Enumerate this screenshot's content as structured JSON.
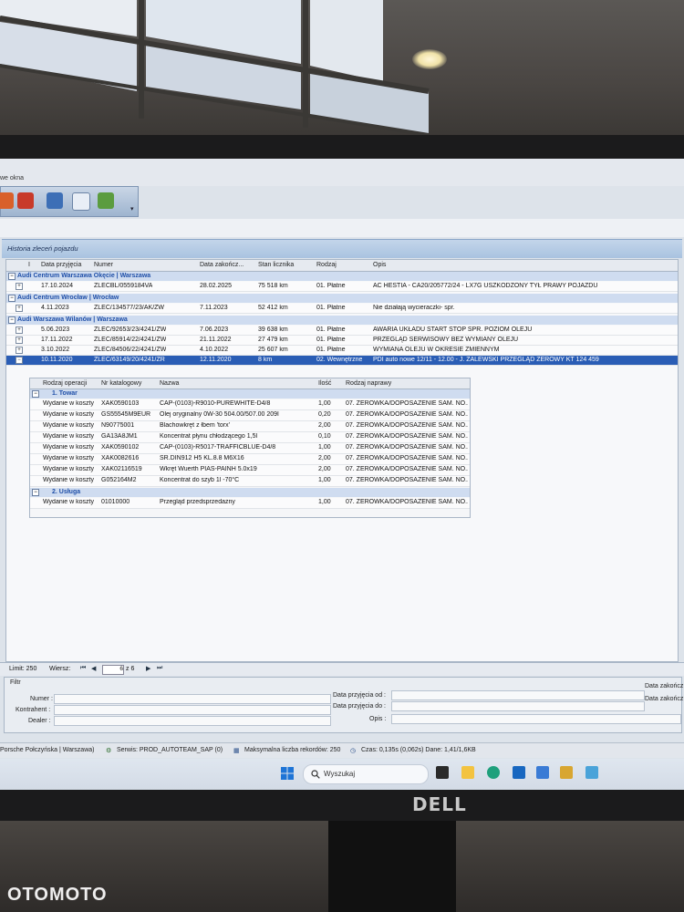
{
  "menu": {
    "text": "we okna"
  },
  "panel_title": "Historia zleceń pojazdu",
  "columns": [
    "Data przyjęcia",
    "Numer",
    "Data zakończ...",
    "Stan licznika",
    "Rodzaj",
    "Opis"
  ],
  "groups": [
    {
      "name": "Audi Centrum Warszawa Okęcie | Warszawa",
      "rows": [
        {
          "date": "17.10.2024",
          "number": "ZLECBL/0559184VA",
          "end": "28.02.2025",
          "km": "75 518 km",
          "type": "01. Płatne",
          "desc": "AC HESTIA - CA20/205772/24 - LX7G USZKODZONY TYŁ PRAWY POJAZDU"
        }
      ]
    },
    {
      "name": "Audi Centrum Wrocław | Wrocław",
      "rows": [
        {
          "date": "4.11.2023",
          "number": "ZLEC/134577/23/AK/ZW",
          "end": "7.11.2023",
          "km": "52 412 km",
          "type": "01. Płatne",
          "desc": "Nie działają wycieraczki- spr."
        }
      ]
    },
    {
      "name": "Audi Warszawa Wilanów | Warszawa",
      "rows": [
        {
          "date": "5.06.2023",
          "number": "ZLEC/92653/23/4241/ZW",
          "end": "7.06.2023",
          "km": "39 638 km",
          "type": "01. Płatne",
          "desc": "AWARIA UKŁADU START STOP SPR. POZIOM OLEJU"
        },
        {
          "date": "17.11.2022",
          "number": "ZLEC/85914/22/4241/ZW",
          "end": "21.11.2022",
          "km": "27 479 km",
          "type": "01. Płatne",
          "desc": "PRZEGLĄD SERWISOWY BEZ WYMIANY OLEJU"
        },
        {
          "date": "3.10.2022",
          "number": "ZLEC/84506/22/4241/ZW",
          "end": "4.10.2022",
          "km": "25 607 km",
          "type": "01. Płatne",
          "desc": "WYMIANA OLEJU W OKRESIE ZMIENNYM"
        },
        {
          "date": "10.11.2020",
          "number": "ZLEC/63149/20/4241/ZR",
          "end": "12.11.2020",
          "km": "8 km",
          "type": "02. Wewnętrzne",
          "desc": "PDI auto nowe  12/11 - 12.00 - J. ZALEWSKI PRZEGLĄD ZEROWY KT  124  459"
        }
      ]
    }
  ],
  "sub_columns": [
    "Rodzaj operacji",
    "Nr katalogowy",
    "Nazwa",
    "Ilość",
    "Rodzaj naprawy"
  ],
  "sub_groups": [
    {
      "name": "1. Towar",
      "rows": [
        {
          "op": "Wydanie w koszty",
          "cat": "XAK0590103",
          "name": "CAP-(0103)-R9010-PUREWHITE-D4/8",
          "qty": "1,00",
          "repair": "07.  ZEROWKA/DOPOSAZENIE  SAM.  NO..."
        },
        {
          "op": "Wydanie w koszty",
          "cat": "GS55545M9EUR",
          "name": "Olej oryginalny 0W-30 504.00/507.00 209l",
          "qty": "0,20",
          "repair": "07.  ZEROWKA/DOPOSAZENIE  SAM.  NO..."
        },
        {
          "op": "Wydanie w koszty",
          "cat": "N90775001",
          "name": "Blachowkręt z łbem 'torx'",
          "qty": "2,00",
          "repair": "07.  ZEROWKA/DOPOSAZENIE  SAM.  NO..."
        },
        {
          "op": "Wydanie w koszty",
          "cat": "GA13A8JM1",
          "name": "Koncentrat płynu chłodzącego 1,5l",
          "qty": "0,10",
          "repair": "07.  ZEROWKA/DOPOSAZENIE  SAM.  NO..."
        },
        {
          "op": "Wydanie w koszty",
          "cat": "XAK0590102",
          "name": "CAP-(0103)-R5017-TRAFFICBLUE-D4/8",
          "qty": "1,00",
          "repair": "07.  ZEROWKA/DOPOSAZENIE  SAM.  NO..."
        },
        {
          "op": "Wydanie w koszty",
          "cat": "XAK0082616",
          "name": "SR.DIN912 H5 KL.8.8 M6X16",
          "qty": "2,00",
          "repair": "07.  ZEROWKA/DOPOSAZENIE  SAM.  NO..."
        },
        {
          "op": "Wydanie w koszty",
          "cat": "XAK02116519",
          "name": "Wkręt Wuerth PIAS-PAINH 5.0x19",
          "qty": "2,00",
          "repair": "07.  ZEROWKA/DOPOSAZENIE  SAM.  NO..."
        },
        {
          "op": "Wydanie w koszty",
          "cat": "G052164M2",
          "name": "Koncentrat do szyb 1l -70°C",
          "qty": "1,00",
          "repair": "07.  ZEROWKA/DOPOSAZENIE  SAM.  NO..."
        }
      ]
    },
    {
      "name": "2. Usługa",
      "rows": [
        {
          "op": "Wydanie w koszty",
          "cat": "01010000",
          "name": "Przegląd przedsprzedażny",
          "qty": "1,00",
          "repair": "07.  ZEROWKA/DOPOSAZENIE  SAM.  NO..."
        }
      ]
    }
  ],
  "footer": {
    "limit": "Limit: 250",
    "rows_label": "Wiersz:",
    "page": "6",
    "of": "z 6"
  },
  "filter": {
    "title": "Filtr",
    "numer": "Numer :",
    "kontrahent": "Kontrahent :",
    "dealer": "Dealer :",
    "date_from": "Data przyjęcia od :",
    "date_to": "Data przyjęcia do :",
    "opis": "Opis :",
    "date_end_from": "Data zakończ",
    "date_end_to": "Data zakończ"
  },
  "status": {
    "dealer": "Porsche Połczyńska | Warszawa)",
    "server": "Serwis: PROD_AUTOTEAM_SAP (0)",
    "max": "Maksymalna liczba rekordów: 250",
    "time": "Czas: 0,135s (0,062s) Dane: 1,41/1,6KB"
  },
  "taskbar": {
    "search_placeholder": "Wyszukaj"
  },
  "monitor_brand": "DELL",
  "watermark": "OTOMOTO"
}
